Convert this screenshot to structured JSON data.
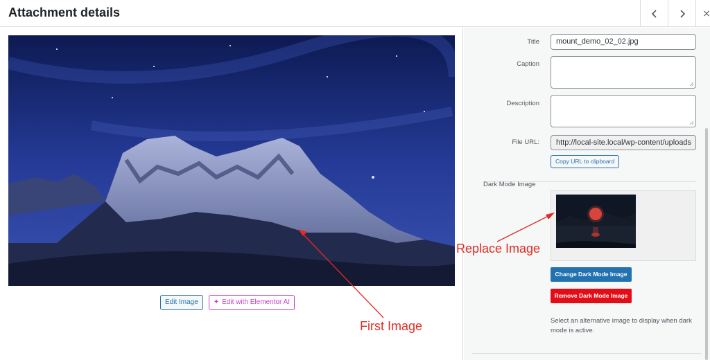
{
  "header": {
    "title": "Attachment details",
    "prev_icon": "chevron-left-icon",
    "next_icon": "chevron-right-icon",
    "close_icon": "close-icon"
  },
  "preview": {
    "edit_image_label": "Edit Image",
    "edit_elementor_label": "Edit with Elementor AI",
    "elementor_icon": "sparkle-icon"
  },
  "annotations": {
    "first": "First Image",
    "replace": "Replace Image",
    "color": "#e52a22"
  },
  "details": {
    "title_label": "Title",
    "title_value": "mount_demo_02_02.jpg",
    "caption_label": "Caption",
    "caption_value": "",
    "description_label": "Description",
    "description_value": "",
    "file_url_label": "File URL:",
    "file_url_value": "http://local-site.local/wp-content/uploads",
    "copy_url_label": "Copy URL to clipboard",
    "dark_mode_label": "Dark Mode Image",
    "change_button": "Change Dark Mode Image",
    "remove_button": "Remove Dark Mode Image",
    "help_text": "Select an alternative image to display when dark mode is active."
  },
  "colors": {
    "accent": "#2271b1",
    "danger": "#e30d17",
    "elementor": "#c93ec6"
  }
}
